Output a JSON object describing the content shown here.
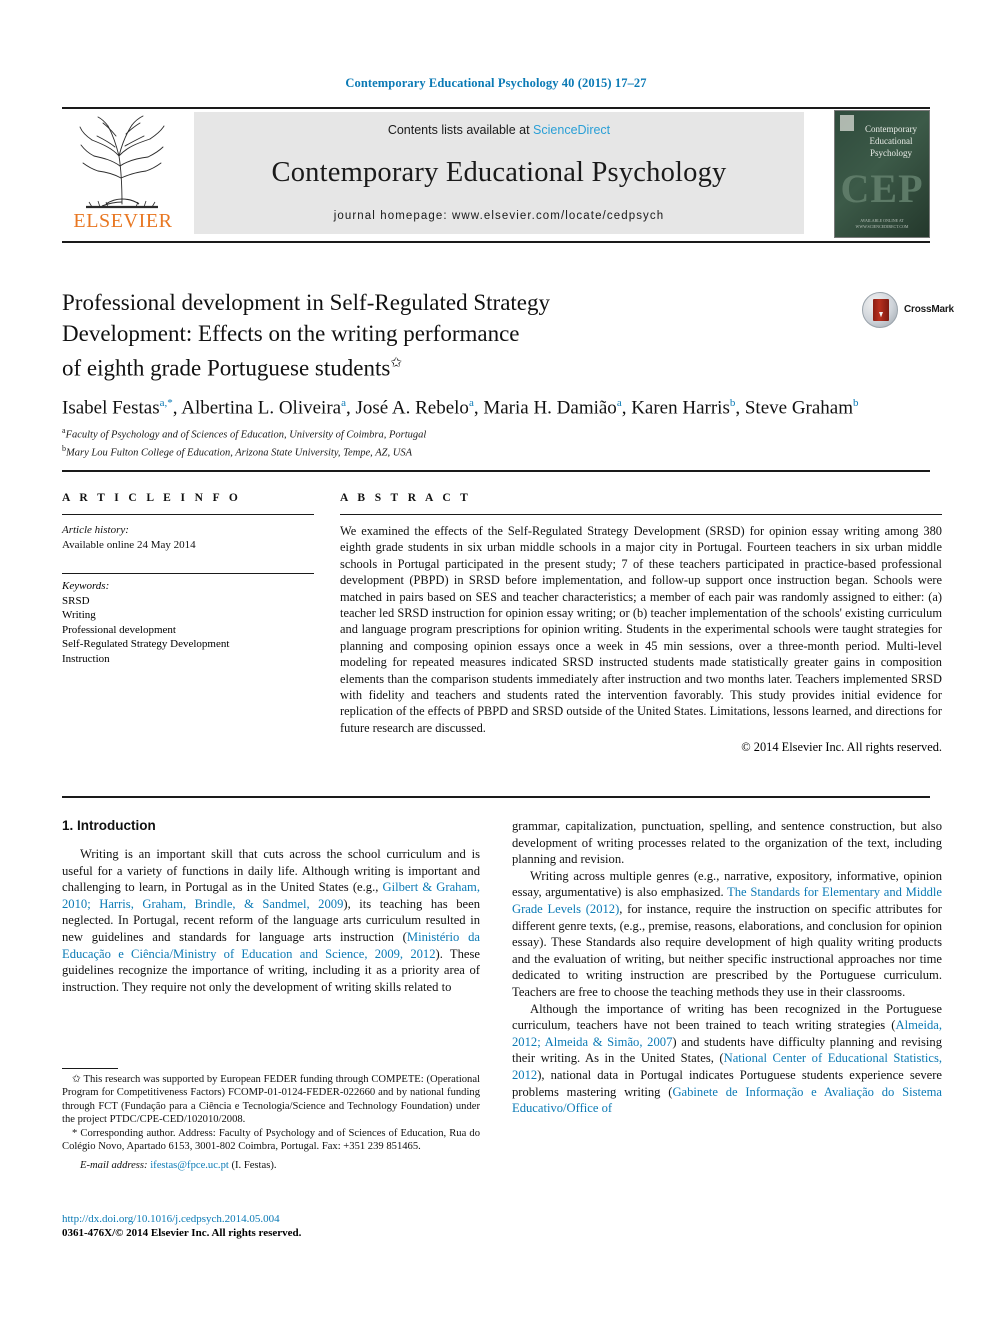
{
  "running_head": "Contemporary Educational Psychology 40 (2015) 17–27",
  "header": {
    "contents_prefix": "Contents lists available at",
    "sciencedirect": "ScienceDirect",
    "journal_title": "Contemporary Educational Psychology",
    "homepage": "journal homepage: www.elsevier.com/locate/cedpsych",
    "publisher": "ELSEVIER",
    "cover": {
      "title_line1": "Contemporary",
      "title_line2": "Educational",
      "title_line3": "Psychology",
      "acronym": "CEP",
      "footer": "AVAILABLE ONLINE AT WWW.SCIENCEDIRECT.COM"
    }
  },
  "article": {
    "title_line1": "Professional development in Self-Regulated Strategy",
    "title_line2": "Development: Effects on the writing performance",
    "title_line3": "of eighth grade Portuguese students",
    "title_star": "✩",
    "crossmark_label": "CrossMark",
    "authors": "Isabel Festas a,*, Albertina L. Oliveira a, José A. Rebelo a, Maria H. Damião a, Karen Harris b, Steve Graham b",
    "affiliation_a": "Faculty of Psychology and of Sciences of Education, University of Coimbra, Portugal",
    "affiliation_b": "Mary Lou Fulton College of Education, Arizona State University, Tempe, AZ, USA"
  },
  "article_info": {
    "heading": "A R T I C L E   I N F O",
    "history_label": "Article history:",
    "history_value": "Available online 24 May 2014",
    "keywords_label": "Keywords:",
    "keywords": [
      "SRSD",
      "Writing",
      "Professional development",
      "Self-Regulated Strategy Development",
      "Instruction"
    ]
  },
  "abstract": {
    "heading": "A B S T R A C T",
    "text": "We examined the effects of the Self-Regulated Strategy Development (SRSD) for opinion essay writing among 380 eighth grade students in six urban middle schools in a major city in Portugal. Fourteen teachers in six urban middle schools in Portugal participated in the present study; 7 of these teachers participated in practice-based professional development (PBPD) in SRSD before implementation, and follow-up support once instruction began. Schools were matched in pairs based on SES and teacher characteristics; a member of each pair was randomly assigned to either: (a) teacher led SRSD instruction for opinion essay writing; or (b) teacher implementation of the schools' existing curriculum and language program prescriptions for opinion writing. Students in the experimental schools were taught strategies for planning and composing opinion essays once a week in 45 min sessions, over a three-month period. Multi-level modeling for repeated measures indicated SRSD instructed students made statistically greater gains in composition elements than the comparison students immediately after instruction and two months later. Teachers implemented SRSD with fidelity and teachers and students rated the intervention favorably. This study provides initial evidence for replication of the effects of PBPD and SRSD outside of the United States. Limitations, lessons learned, and directions for future research are discussed.",
    "copyright": "© 2014 Elsevier Inc. All rights reserved."
  },
  "body": {
    "section_heading": "1. Introduction",
    "left_para1_a": "Writing is an important skill that cuts across the school curriculum and is useful for a variety of functions in daily life. Although writing is important and challenging to learn, in Portugal as in the United States (e.g., ",
    "left_para1_ref1": "Gilbert & Graham, 2010; Harris, Graham, Brindle, & Sandmel, 2009",
    "left_para1_b": "), its teaching has been neglected. In Portugal, recent reform of the language arts curriculum resulted in new guidelines and standards for language arts instruction (",
    "left_para1_ref2": "Ministério da Educação e Ciência/Ministry of Education and Science, 2009, 2012",
    "left_para1_c": "). These guidelines recognize the importance of writing, including it as a priority area of instruction. They require not only the development of writing skills related to",
    "right_para1": "grammar, capitalization, punctuation, spelling, and sentence construction, but also development of writing processes related to the organization of the text, including planning and revision.",
    "right_para2_a": "Writing across multiple genres (e.g., narrative, expository, informative, opinion essay, argumentative) is also emphasized. ",
    "right_para2_ref1": "The Standards for Elementary and Middle Grade Levels (2012)",
    "right_para2_b": ", for instance, require the instruction on specific attributes for different genre texts, (e.g., premise, reasons, elaborations, and conclusion for opinion essay). These Standards also require development of high quality writing products and the evaluation of writing, but neither specific instructional approaches nor time dedicated to writing instruction are prescribed by the Portuguese curriculum. Teachers are free to choose the teaching methods they use in their classrooms.",
    "right_para3_a": "Although the importance of writing has been recognized in the Portuguese curriculum, teachers have not been trained to teach writing strategies (",
    "right_para3_ref1": "Almeida, 2012; Almeida & Simão, 2007",
    "right_para3_b": ") and students have difficulty planning and revising their writing. As in the United States, (",
    "right_para3_ref2": "National Center of Educational Statistics, 2012",
    "right_para3_c": "), national data in Portugal indicates Portuguese students experience severe problems mastering writing (",
    "right_para3_ref3": "Gabinete de Informação e Avaliação do Sistema Educativo/Office of"
  },
  "footnotes": {
    "funding_marker": "✩",
    "funding": "This research was supported by European FEDER funding through COMPETE: (Operational Program for Competitiveness Factors) FCOMP-01-0124-FEDER-022660 and by national funding through FCT (Fundação para a Ciência e Tecnologia/Science and Technology Foundation) under the project PTDC/CPE-CED/102010/2008.",
    "corresponding_marker": "*",
    "corresponding": "Corresponding author. Address: Faculty of Psychology and of Sciences of Education, Rua do Colégio Novo, Apartado 6153, 3001-802 Coimbra, Portugal. Fax: +351 239 851465.",
    "email_label": "E-mail address:",
    "email_value": "ifestas@fpce.uc.pt",
    "email_owner": "(I. Festas)."
  },
  "footer": {
    "doi": "http://dx.doi.org/10.1016/j.cedpsych.2014.05.004",
    "issn_copyright": "0361-476X/© 2014 Elsevier Inc. All rights reserved."
  },
  "colors": {
    "link": "#0b7ab5",
    "sciencedirect": "#2a9fd6",
    "elsevier_orange": "#e87722",
    "cover_green": "#2f4b3c"
  }
}
